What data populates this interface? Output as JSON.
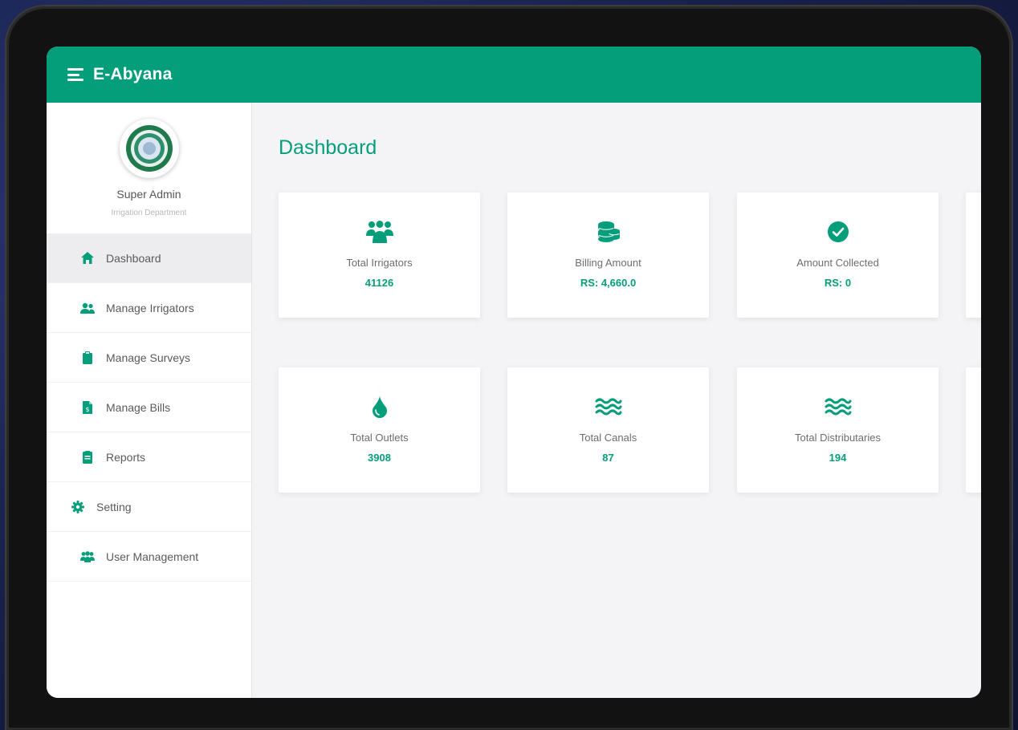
{
  "app": {
    "title": "E-Abyana"
  },
  "colors": {
    "brand": "#059e7b",
    "sidebar_bg": "#ffffff",
    "content_bg": "#f4f4f6"
  },
  "profile": {
    "name": "Super Admin",
    "department": "Irrigation Department"
  },
  "sidebar": {
    "items": [
      {
        "label": "Dashboard",
        "icon": "home-icon",
        "active": true
      },
      {
        "label": "Manage Irrigators",
        "icon": "users-icon"
      },
      {
        "label": "Manage Surveys",
        "icon": "clipboard-icon"
      },
      {
        "label": "Manage Bills",
        "icon": "bill-icon"
      },
      {
        "label": "Reports",
        "icon": "report-icon"
      },
      {
        "label": "Setting",
        "icon": "gear-icon"
      },
      {
        "label": "User Management",
        "icon": "user-management-icon"
      }
    ]
  },
  "main": {
    "title": "Dashboard",
    "cards": [
      {
        "label": "Total Irrigators",
        "value": "41126",
        "icon": "users-icon"
      },
      {
        "label": "Billing Amount",
        "value": "RS: 4,660.0",
        "icon": "coins-icon"
      },
      {
        "label": "Amount Collected",
        "value": "RS: 0",
        "icon": "check-circle-icon"
      },
      {
        "label": "Total Outlets",
        "value": "3908",
        "icon": "water-drop-icon"
      },
      {
        "label": "Total Canals",
        "value": "87",
        "icon": "water-waves-icon"
      },
      {
        "label": "Total Distributaries",
        "value": "194",
        "icon": "water-waves-icon"
      }
    ]
  }
}
